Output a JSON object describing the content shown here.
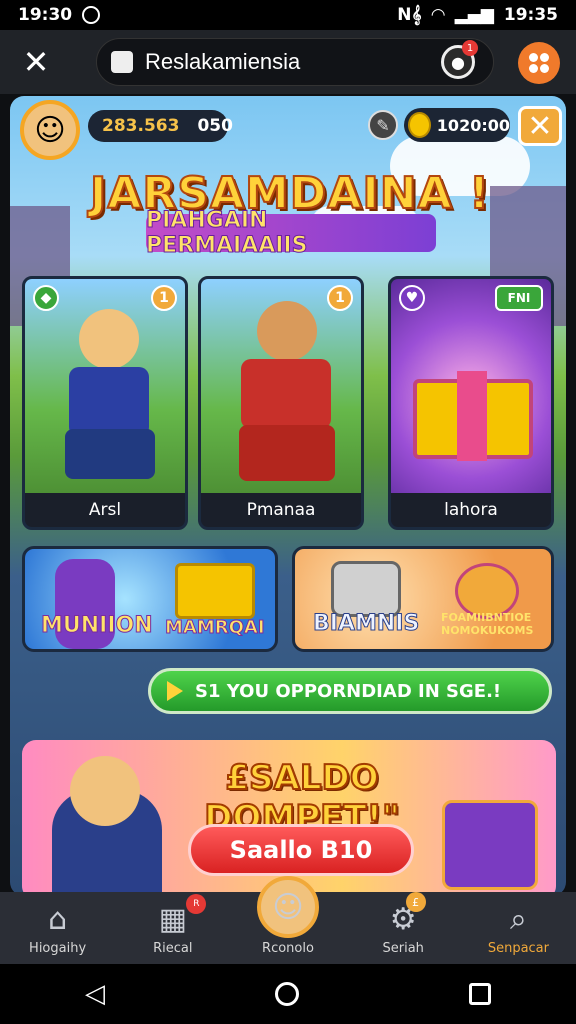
{
  "status_bar": {
    "time": "19:30",
    "clock_right": "19:35",
    "net": "N𝄞"
  },
  "browser": {
    "url_title": "Reslakamiensia",
    "notif_count": "1"
  },
  "game": {
    "coins": "283.563",
    "coins_small": "050",
    "gems": "1020:00",
    "title": "JARSAMDAINA !",
    "subtitle": "PIAHGAIN PERMAIAAIIS",
    "cards": [
      {
        "label": "Arsl",
        "badge": "1"
      },
      {
        "label": "Pmanaa",
        "badge": "1"
      },
      {
        "label": "lahora",
        "badge": "FNI"
      }
    ],
    "banner_left_texts": [
      "MUNIION",
      "MAMRQAI"
    ],
    "banner_right_texts": [
      "BIAMNIS",
      "FOAMIIBNTIOE NOMOKUKOMS"
    ],
    "promo_bar": "S1 YOU OPPORNDIAD IN SGE.!",
    "saldo_title": "£SALDO DOMPET!\"",
    "saldo_button": "Saallo B10"
  },
  "tabbar": {
    "items": [
      {
        "label": "Hiogaihy",
        "icon": "home-icon"
      },
      {
        "label": "Riecal",
        "icon": "grid-icon",
        "badge": "R"
      },
      {
        "label": "Rconolo",
        "icon": "profile-avatar-icon"
      },
      {
        "label": "Seriah",
        "icon": "gear-icon",
        "badge": "£"
      },
      {
        "label": "Senpacar",
        "icon": "search-icon"
      }
    ]
  },
  "colors": {
    "accent": "#f1a93a",
    "green": "#2fae2f",
    "title_yellow": "#ffd23a"
  }
}
